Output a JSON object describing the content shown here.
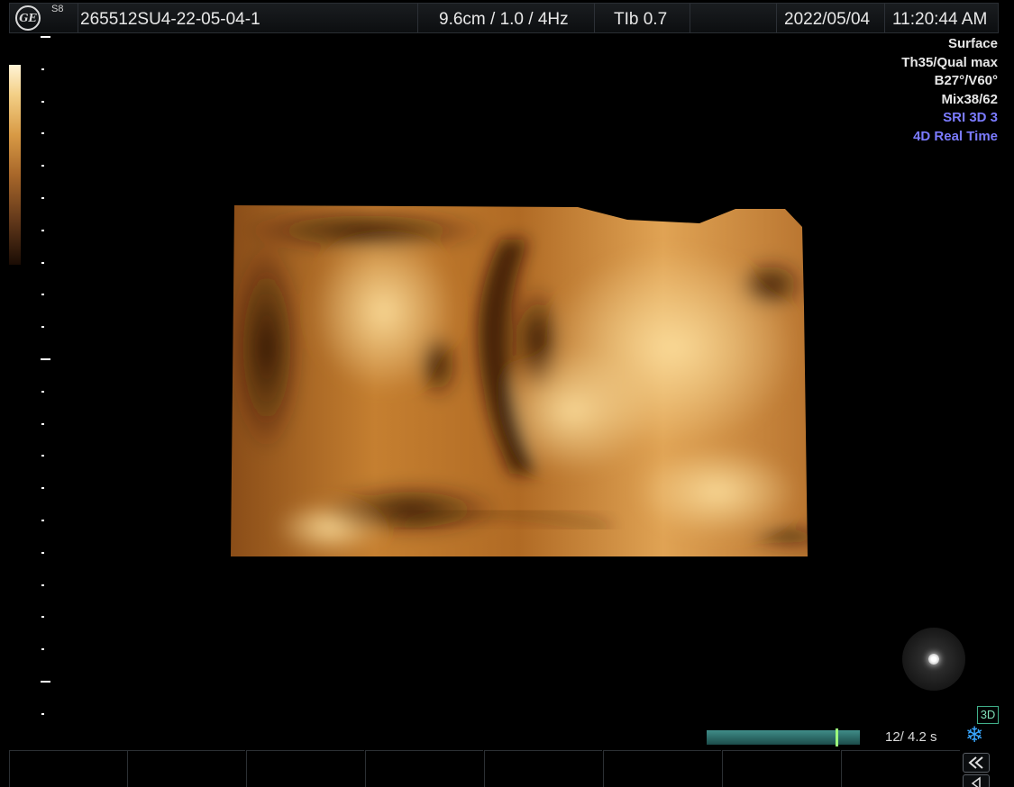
{
  "header": {
    "probe": "S8",
    "patient_id": "265512SU4-22-05-04-1",
    "depth_params": "9.6cm / 1.0 /  4Hz",
    "tib": "TIb  0.7",
    "date": "2022/05/04",
    "time": "11:20:44 AM"
  },
  "info_panel": {
    "lines": [
      {
        "text": "Surface",
        "color": "#e6e6e6"
      },
      {
        "text": "Th35/Qual max",
        "color": "#e6e6e6"
      },
      {
        "text": "B27°/V60°",
        "color": "#e6e6e6"
      },
      {
        "text": "Mix38/62",
        "color": "#e6e6e6"
      },
      {
        "text": "SRI 3D 3",
        "color": "#7b7bff"
      },
      {
        "text": "4D Real Time",
        "color": "#7b7bff"
      }
    ]
  },
  "cine": {
    "mode_tag": "3D",
    "frame_info": "12/ 4.2 s",
    "marker_fraction": 0.84,
    "accent": "#3f8c88"
  },
  "icons": {
    "logo": "ge-logo-icon",
    "freeze": "snowflake-icon",
    "rewind": "rewind-icon",
    "back": "triangle-left-icon",
    "light": "light-source-icon"
  },
  "volume_colors": {
    "highlight": "#f8d188",
    "mid": "#c8822e",
    "shadow": "#3a1a06"
  }
}
